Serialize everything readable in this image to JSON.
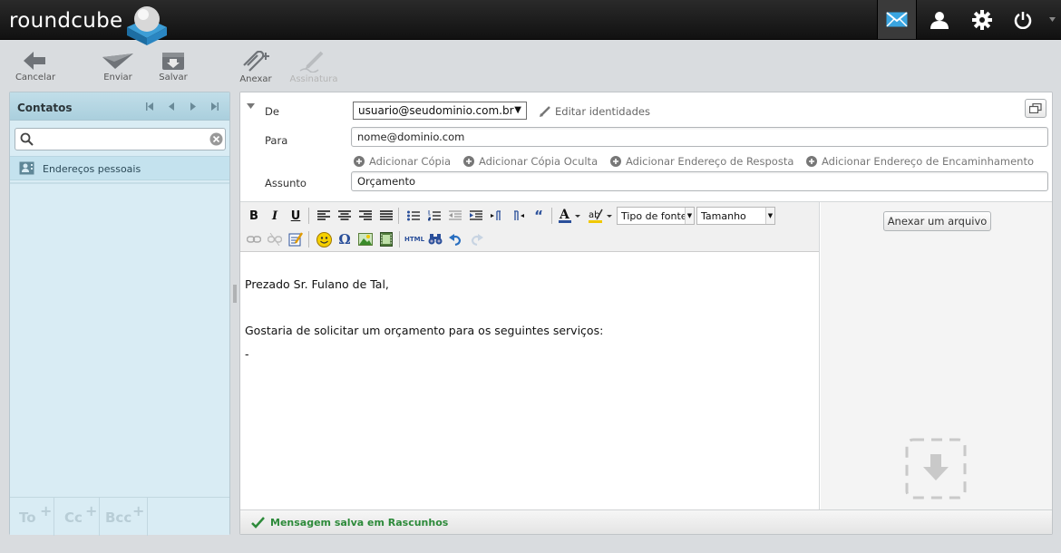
{
  "app": {
    "logo_text": "roundcube"
  },
  "topnav": {
    "items": [
      {
        "name": "mail",
        "icon": "envelope-icon",
        "active": true
      },
      {
        "name": "contacts",
        "icon": "user-icon"
      },
      {
        "name": "settings",
        "icon": "gear-icon"
      },
      {
        "name": "logout",
        "icon": "power-icon"
      }
    ]
  },
  "toolbar": {
    "cancel_label": "Cancelar",
    "send_label": "Enviar",
    "save_label": "Salvar",
    "attach_label": "Anexar",
    "signature_label": "Assinatura"
  },
  "contacts": {
    "title": "Contatos",
    "search_value": "",
    "addressbook_label": "Endereços pessoais",
    "recipients": {
      "to": "To",
      "cc": "Cc",
      "bcc": "Bcc",
      "plus": "+"
    }
  },
  "compose": {
    "from_label": "De",
    "from_value": "usuario@seudominio.com.br",
    "edit_identities": "Editar identidades",
    "to_label": "Para",
    "to_value": "nome@dominio.com",
    "add_cc": "Adicionar Cópia",
    "add_bcc": "Adicionar Cópia Oculta",
    "add_replyto": "Adicionar Endereço de Resposta",
    "add_followupto": "Adicionar Endereço de Encaminhamento",
    "subject_label": "Assunto",
    "subject_value": "Orçamento"
  },
  "editor": {
    "font_family_label": "Tipo de fonte",
    "font_size_label": "Tamanho",
    "body_lines": [
      "Prezado Sr. Fulano de Tal,",
      "Gostaria de solicitar um orçamento para os seguintes serviços:",
      "-"
    ]
  },
  "attachments": {
    "button_label": "Anexar um arquivo"
  },
  "status": {
    "message": "Mensagem salva em Rascunhos",
    "color": "#2d8a3a"
  },
  "colors": {
    "accent": "#3d9ed6",
    "panel_bg": "#d9ecf4",
    "topbar_bg": "#111111"
  }
}
